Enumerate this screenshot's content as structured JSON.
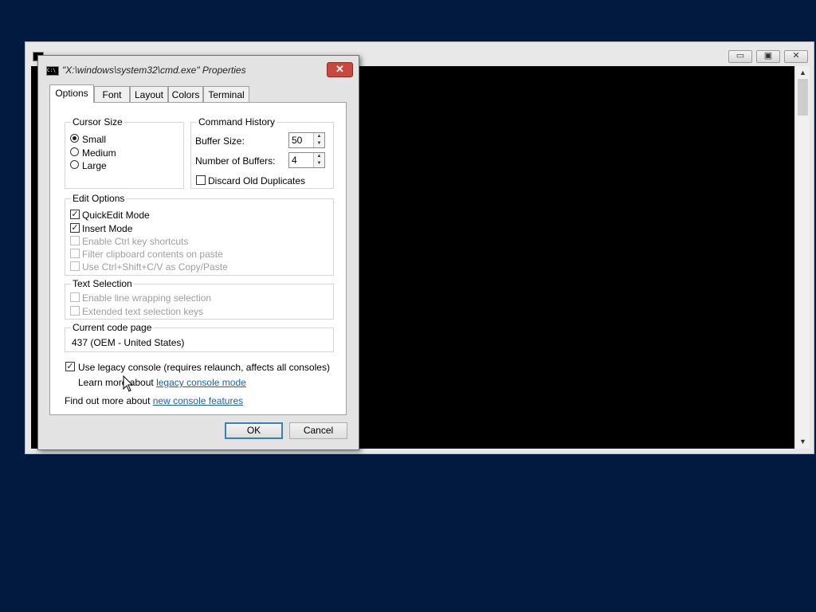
{
  "console_window": {
    "controls": [
      "▭",
      "▣",
      "✕"
    ]
  },
  "dialog": {
    "title": "\"X:\\windows\\system32\\cmd.exe\" Properties",
    "icon_text": "C:\\",
    "close_symbol": "✕",
    "tabs": [
      "Options",
      "Font",
      "Layout",
      "Colors",
      "Terminal"
    ],
    "active_tab": "Options",
    "cursor_size": {
      "label": "Cursor Size",
      "options": [
        "Small",
        "Medium",
        "Large"
      ],
      "selected": "Small"
    },
    "command_history": {
      "label": "Command History",
      "buffer_size_label": "Buffer Size:",
      "buffer_size_value": "50",
      "num_buffers_label": "Number of Buffers:",
      "num_buffers_value": "4",
      "discard_label": "Discard Old Duplicates",
      "discard_checked": false
    },
    "edit_options": {
      "label": "Edit Options",
      "items": [
        {
          "label": "QuickEdit Mode",
          "checked": true,
          "enabled": true
        },
        {
          "label": "Insert Mode",
          "checked": true,
          "enabled": true
        },
        {
          "label": "Enable Ctrl key shortcuts",
          "checked": false,
          "enabled": false
        },
        {
          "label": "Filter clipboard contents on paste",
          "checked": false,
          "enabled": false
        },
        {
          "label": "Use Ctrl+Shift+C/V as Copy/Paste",
          "checked": false,
          "enabled": false
        }
      ]
    },
    "text_selection": {
      "label": "Text Selection",
      "items": [
        {
          "label": "Enable line wrapping selection",
          "checked": false,
          "enabled": false
        },
        {
          "label": "Extended text selection keys",
          "checked": false,
          "enabled": false
        }
      ]
    },
    "code_page": {
      "label": "Current code page",
      "value": "437   (OEM - United States)"
    },
    "legacy": {
      "label": "Use legacy console (requires relaunch, affects all consoles)",
      "checked": true,
      "learn_prefix": "Learn more about ",
      "learn_link": "legacy console mode"
    },
    "features": {
      "prefix": "Find out more about ",
      "link": "new console features"
    },
    "buttons": {
      "ok": "OK",
      "cancel": "Cancel"
    }
  },
  "colors": {
    "desktop": "#021a40",
    "console_bg": "#000000",
    "link": "#1a5fb4",
    "close_button": "#c74a3f"
  }
}
